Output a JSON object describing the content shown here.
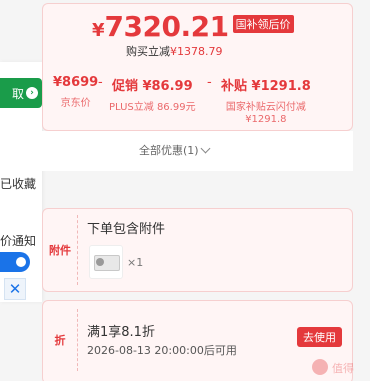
{
  "price": {
    "currency": "¥",
    "amount": "7320.21",
    "badge": "国补领后价",
    "instant_cut_label": "购买立减",
    "instant_cut_value": "¥1378.79"
  },
  "breakdown": {
    "jd_price": {
      "amount": "¥8699",
      "label": "京东价"
    },
    "promo": {
      "amount": "促销 ¥86.99",
      "label": "PLUS立减 86.99元"
    },
    "subsidy": {
      "amount": "补贴 ¥1291.8",
      "label_line1": "国家补贴云闪付减",
      "label_line2": "¥1291.8"
    },
    "separator": "-"
  },
  "offers": {
    "all_label": "全部优惠(1)"
  },
  "left_panel": {
    "claim_label": "取",
    "collect_label": "已收藏",
    "notify_label": "价通知",
    "close_symbol": "✕"
  },
  "accessory": {
    "side_label": "附件",
    "title": "下单包含附件",
    "quantity": "×1"
  },
  "coupon": {
    "side_label": "折",
    "title": "满1享8.1折",
    "time": "2026-08-13 20:00:00后可用",
    "use_label": "去使用"
  },
  "watermark": {
    "text": "值得"
  },
  "colors": {
    "accent_red": "#e4393c",
    "green": "#1a9c4a",
    "blue": "#1a73e8"
  },
  "icons": {
    "claim": "arrow-right-circle-icon",
    "chevron": "chevron-down-icon",
    "close": "close-icon",
    "accessory": "air-conditioner-unit-icon"
  }
}
